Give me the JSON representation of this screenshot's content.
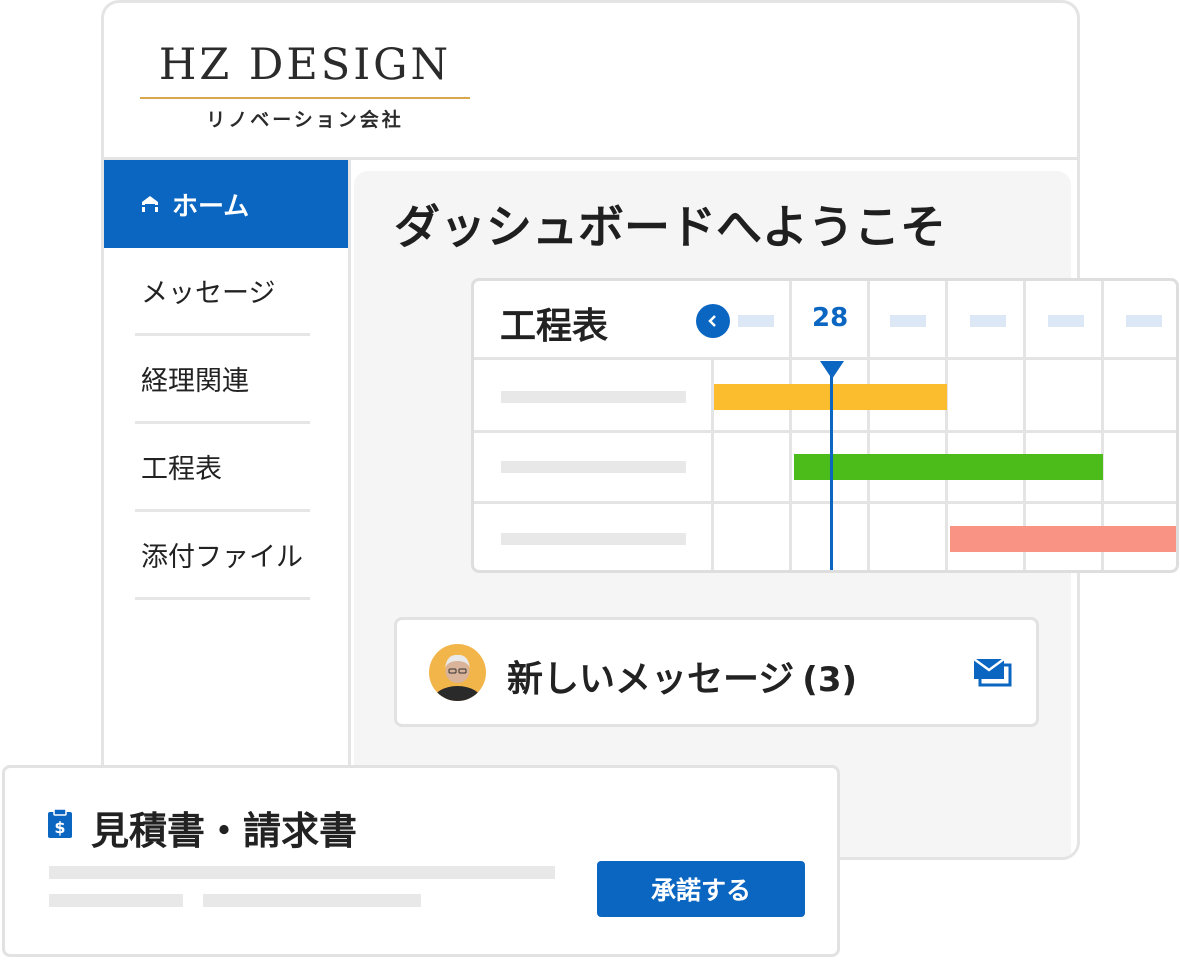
{
  "brand": {
    "name": "HZ DESIGN",
    "subtitle": "リノベーション会社"
  },
  "sidebar": {
    "home_label": "ホーム",
    "items": [
      {
        "label": "メッセージ"
      },
      {
        "label": "経理関連"
      },
      {
        "label": "工程表"
      },
      {
        "label": "添付ファイル"
      }
    ]
  },
  "main": {
    "title": "ダッシュボードへようこそ"
  },
  "schedule": {
    "title": "工程表",
    "current_date": "28",
    "bars": [
      {
        "color": "#fbbc2e"
      },
      {
        "color": "#4cbc1a"
      },
      {
        "color": "#f99383"
      }
    ]
  },
  "messages": {
    "label": "新しいメッセージ",
    "count": "(3)"
  },
  "estimate": {
    "title": "見積書・請求書",
    "approve_label": "承諾する"
  },
  "colors": {
    "accent": "#0b66c2",
    "brand_line": "#d9a84e"
  },
  "icons": [
    "home-icon",
    "chevron-left-icon",
    "mail-icon",
    "invoice-icon"
  ]
}
